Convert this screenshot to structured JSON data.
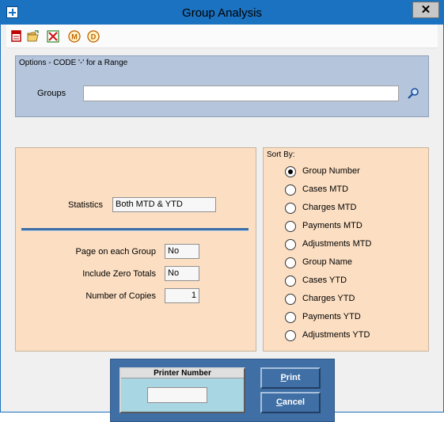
{
  "window": {
    "title": "Group Analysis",
    "close_glyph": "✕"
  },
  "toolbar": {
    "buttons": [
      {
        "icon": "print-report-icon"
      },
      {
        "icon": "open-folder-icon"
      },
      {
        "icon": "cancel-x-icon"
      },
      {
        "icon": "m-circle-icon",
        "glyph": "M"
      },
      {
        "icon": "d-circle-icon",
        "glyph": "D"
      }
    ]
  },
  "options": {
    "title": "Options - CODE '-' for a Range",
    "groups_label": "Groups",
    "groups_value": ""
  },
  "statistics": {
    "label": "Statistics",
    "value": "Both MTD & YTD"
  },
  "page_on_each_group": {
    "label": "Page on each Group",
    "value": "No"
  },
  "include_zero_totals": {
    "label": "Include Zero Totals",
    "value": "No"
  },
  "number_of_copies": {
    "label": "Number of Copies",
    "value": "1"
  },
  "sort_by": {
    "title": "Sort By:",
    "options": [
      {
        "label": "Group Number",
        "checked": true
      },
      {
        "label": "Cases MTD",
        "checked": false
      },
      {
        "label": "Charges MTD",
        "checked": false
      },
      {
        "label": "Payments MTD",
        "checked": false
      },
      {
        "label": "Adjustments MTD",
        "checked": false
      },
      {
        "label": "Group Name",
        "checked": false
      },
      {
        "label": "Cases YTD",
        "checked": false
      },
      {
        "label": "Charges YTD",
        "checked": false
      },
      {
        "label": "Payments YTD",
        "checked": false
      },
      {
        "label": "Adjustments YTD",
        "checked": false
      }
    ]
  },
  "printer": {
    "title": "Printer Number",
    "value": ""
  },
  "buttons": {
    "print_accel": "P",
    "print_rest": "rint",
    "cancel_accel": "C",
    "cancel_rest": "ancel"
  }
}
